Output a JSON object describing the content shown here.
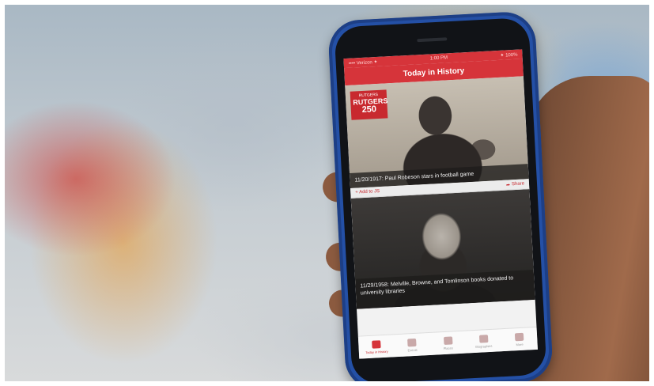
{
  "phone_app": {
    "status": {
      "carrier": "•••• Verizon ✦",
      "time": "1:00 PM",
      "battery": "✦ 100%"
    },
    "title": "Today in History",
    "cards": [
      {
        "badge_top": "RUTGERS",
        "badge_big": "RUTGERS",
        "badge_num": "250",
        "caption": "11/20/1917: Paul Robeson stars in football game"
      },
      {
        "caption": "11/29/1958: Melville, Browne, and Tomlinson books donated to university libraries"
      }
    ],
    "action_row": {
      "add_label": "+ Add to JS",
      "share_label": "Share",
      "share_icon": "share-icon"
    },
    "tabs": [
      {
        "label": "Today in History",
        "active": true
      },
      {
        "label": "Events",
        "active": false
      },
      {
        "label": "Places",
        "active": false
      },
      {
        "label": "Biographies",
        "active": false
      },
      {
        "label": "More",
        "active": false
      }
    ],
    "colors": {
      "accent": "#d6343a",
      "phone_case": "#2450a6"
    }
  }
}
